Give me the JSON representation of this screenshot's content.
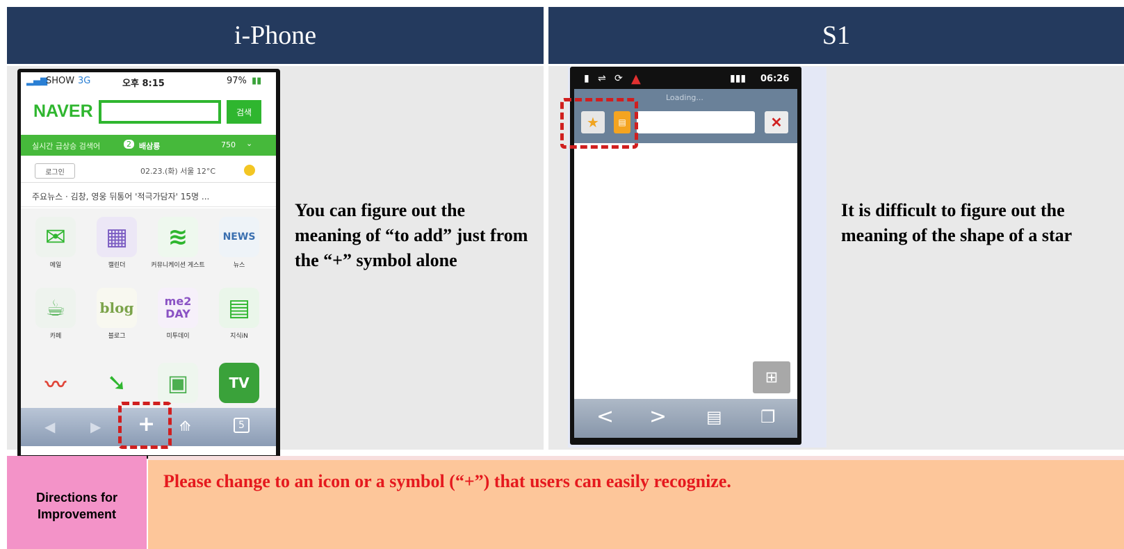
{
  "headers": {
    "left": "i-Phone",
    "right": "S1"
  },
  "iphone": {
    "status": {
      "carrier": "SHOW",
      "network": "3G",
      "time": "오후 8:15",
      "battery": "97%"
    },
    "naver": {
      "logo": "NAVER",
      "search_button": "검색"
    },
    "realtime": {
      "label": "실시간 급상승 검색어",
      "rank": "2",
      "keyword": "배삼룡",
      "count": "750"
    },
    "login": {
      "button": "로그인",
      "weather": "02.23.(화) 서울 12°C"
    },
    "news": "주요뉴스 · 김창, 영웅 뒤통어 '적극가담자' 15명 ...",
    "apps": [
      {
        "label": "메일",
        "icon": "mail-icon",
        "glyph": "✉"
      },
      {
        "label": "캘린더",
        "icon": "calendar-icon",
        "glyph": "▦"
      },
      {
        "label": "커뮤니케이션 게스트",
        "icon": "wifi-icon",
        "glyph": "≋"
      },
      {
        "label": "뉴스",
        "icon": "news-icon",
        "glyph": "NEWS"
      },
      {
        "label": "카페",
        "icon": "cafe-icon",
        "glyph": "☕"
      },
      {
        "label": "블로그",
        "icon": "blog-icon",
        "glyph": "blog"
      },
      {
        "label": "미투데이",
        "icon": "me2day-icon",
        "glyph": "me2 DAY"
      },
      {
        "label": "지식iN",
        "icon": "knowledge-icon",
        "glyph": "▤"
      },
      {
        "label": "",
        "icon": "stock-chart-icon",
        "glyph": "〰"
      },
      {
        "label": "",
        "icon": "map-icon",
        "glyph": "➘"
      },
      {
        "label": "",
        "icon": "book-icon",
        "glyph": "▣"
      },
      {
        "label": "",
        "icon": "tv-icon",
        "glyph": "TV"
      }
    ],
    "toolbar": {
      "back": "◀",
      "forward": "▶",
      "add": "+",
      "bookmarks": "📖",
      "pages": "5"
    }
  },
  "s1": {
    "status_time": "06:26",
    "loading": "Loading...",
    "close": "✕",
    "star": "★",
    "bottom": {
      "back": "<",
      "forward": ">",
      "page": "▤",
      "windows": "❐"
    }
  },
  "notes": {
    "left": "You can figure out the meaning of “to add” just from the “+” symbol alone",
    "right": "It is difficult to figure out the meaning of the shape of a star"
  },
  "improvement": {
    "label": "Directions for Improvement",
    "text": "Please change to an icon or a symbol (“+”) that users can easily recognize."
  },
  "colors": {
    "header_bg": "#243a5e",
    "naver_green": "#2fb62f",
    "dash_red": "#d01f1f",
    "pink": "#f393c8",
    "orange": "#fdc69a"
  }
}
